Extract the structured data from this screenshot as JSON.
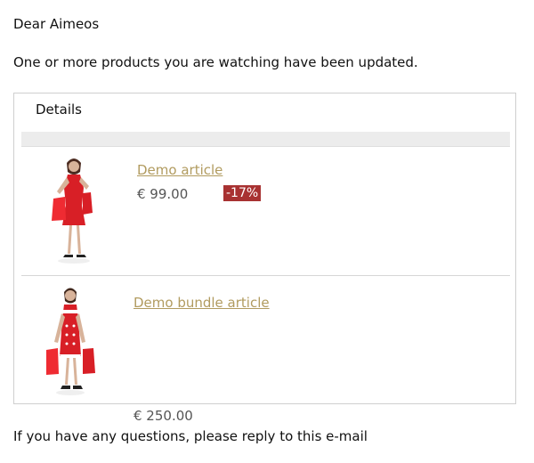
{
  "email": {
    "greeting": "Dear Aimeos",
    "intro": "One or more products you are watching have been updated.",
    "details_heading": "Details",
    "footer": "If you have any questions, please reply to this e-mail"
  },
  "products": [
    {
      "name": "Demo article",
      "price": "€ 99.00",
      "discount": "-17%",
      "image": "woman-red-dress-image"
    },
    {
      "name": "Demo bundle article",
      "price": "€ 250.00",
      "image": "woman-red-dress-image"
    }
  ],
  "colors": {
    "link": "#b19b5f",
    "discount_badge": "#a83232",
    "dress_red": "#d81f26",
    "border": "#cfcfcf",
    "header_bar": "#ececec"
  }
}
